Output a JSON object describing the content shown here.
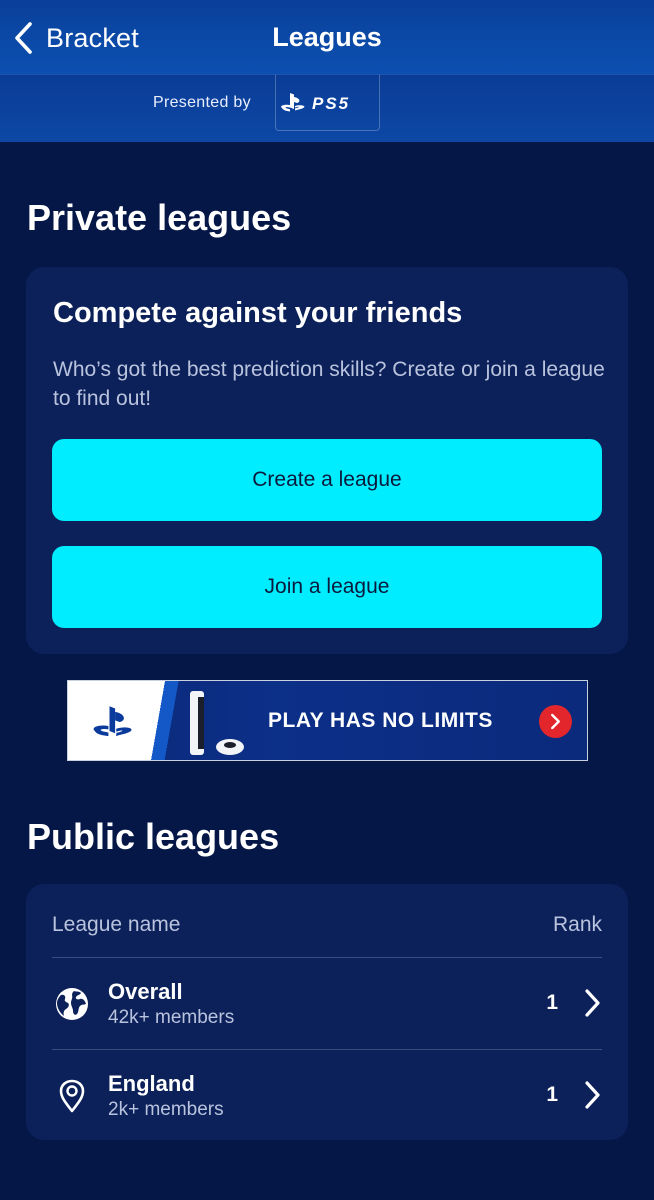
{
  "header": {
    "back_label": "Bracket",
    "title": "Leagues",
    "presented_by": "Presented by",
    "sponsor": "PS5"
  },
  "private_leagues": {
    "title": "Private leagues",
    "card": {
      "heading": "Compete against your friends",
      "description": "Who’s got the best prediction skills? Create or join a league to find out!",
      "create_button": "Create a league",
      "join_button": "Join a league"
    }
  },
  "ad": {
    "text": "PLAY HAS NO LIMITS",
    "brand_icon": "playstation-logo-icon",
    "arrow_icon": "chevron-right-icon"
  },
  "public_leagues": {
    "title": "Public leagues",
    "columns": {
      "name": "League name",
      "rank": "Rank"
    },
    "rows": [
      {
        "icon": "globe-icon",
        "name": "Overall",
        "members": "42k+ members",
        "rank": "1"
      },
      {
        "icon": "location-pin-icon",
        "name": "England",
        "members": "2k+ members",
        "rank": "1"
      }
    ]
  },
  "colors": {
    "background": "#051747",
    "card": "#0c2159",
    "accent_button": "#00ecff",
    "header": "#0b4aa8",
    "ad_arrow": "#e3262c"
  }
}
